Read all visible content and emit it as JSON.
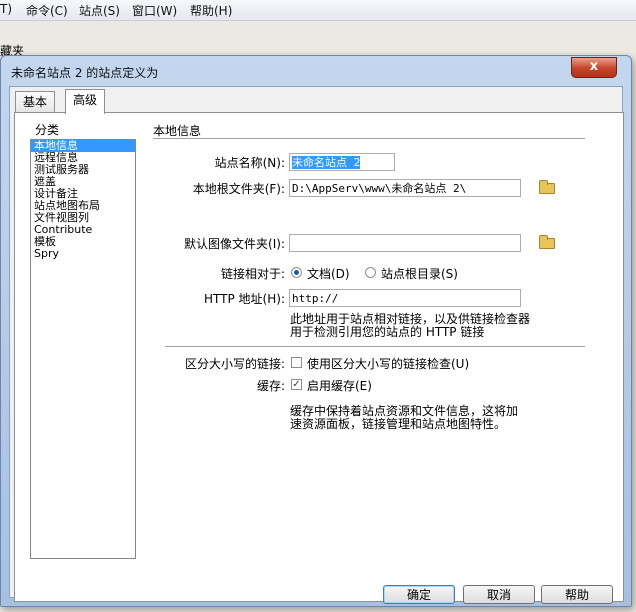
{
  "menubar": {
    "items": [
      "T)",
      "命令(C)",
      "站点(S)",
      "窗口(W)",
      "帮助(H)"
    ]
  },
  "behind_panel_title": "藏夹",
  "dialog": {
    "title": "未命名站点 2 的站点定义为",
    "close_label": "x",
    "tabs": [
      "基本",
      "高级"
    ],
    "category_label": "分类",
    "categories": [
      "本地信息",
      "远程信息",
      "测试服务器",
      "遮盖",
      "设计备注",
      "站点地图布局",
      "文件视图列",
      "Contribute",
      "模板",
      "Spry"
    ],
    "section_title": "本地信息",
    "site_name_label": "站点名称(N):",
    "site_name_value": "未命名站点 2",
    "local_root_label": "本地根文件夹(F):",
    "local_root_value": "D:\\AppServ\\www\\未命名站点 2\\",
    "default_images_label": "默认图像文件夹(I):",
    "default_images_value": "",
    "links_relative_label": "链接相对于:",
    "radio_document": "文档(D)",
    "radio_site_root": "站点根目录(S)",
    "http_label": "HTTP 地址(H):",
    "http_value": "http://",
    "http_note": "此地址用于站点相对链接，以及供链接检查器用于检测引用您的站点的 HTTP 链接",
    "case_label": "区分大小写的链接:",
    "case_option": "使用区分大小写的链接检查(U)",
    "cache_label": "缓存:",
    "cache_option": "启用缓存(E)",
    "cache_note": "缓存中保持着站点资源和文件信息，这将加速资源面板，链接管理和站点地图特性。",
    "ok_button": "确定",
    "cancel_button": "取消",
    "help_button": "帮助"
  }
}
